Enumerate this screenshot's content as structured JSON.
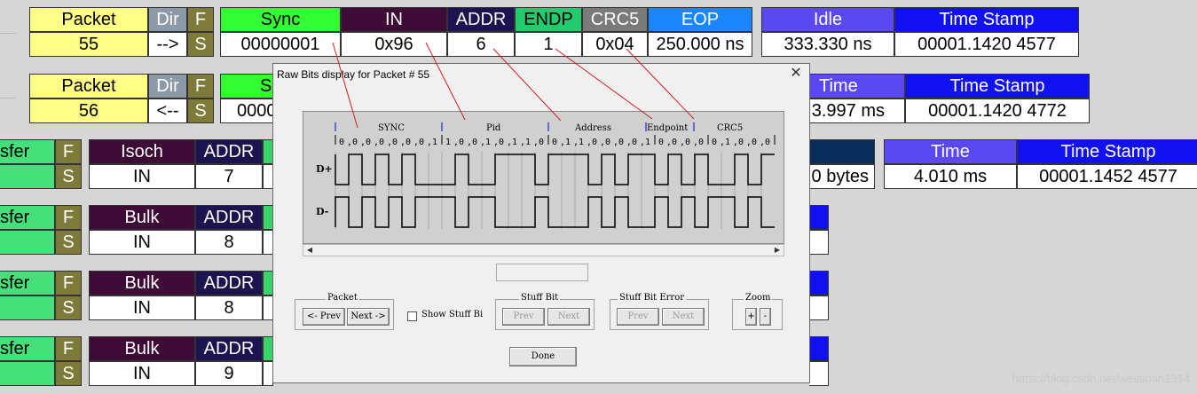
{
  "row1": {
    "headers": [
      "Packet",
      "Dir",
      "F",
      "Sync",
      "IN",
      "ADDR",
      "ENDP",
      "CRC5",
      "EOP",
      "Idle",
      "Time Stamp"
    ],
    "values": [
      "55",
      "-->",
      "S",
      "00000001",
      "0x96",
      "6",
      "1",
      "0x04",
      "250.000 ns",
      "333.330 ns",
      "00001.1420 4577"
    ]
  },
  "row2": {
    "headers": [
      "Packet",
      "Dir",
      "F",
      "S",
      "Time",
      "Time Stamp"
    ],
    "values": [
      "56",
      "<--",
      "S",
      "0000",
      "3.997 ms",
      "00001.1420 4772"
    ]
  },
  "row3": {
    "headers": [
      "sfer",
      "F",
      "Isoch",
      "ADDR",
      "Time",
      "Time Stamp"
    ],
    "values": [
      "S",
      "IN",
      "7",
      "0 bytes",
      "4.010 ms",
      "00001.1452 4577"
    ]
  },
  "row4": {
    "headers": [
      "sfer",
      "F",
      "Bulk",
      "ADDR"
    ],
    "values": [
      "S",
      "IN",
      "8"
    ]
  },
  "row5": {
    "headers": [
      "sfer",
      "F",
      "Bulk",
      "ADDR"
    ],
    "values": [
      "S",
      "IN",
      "8"
    ]
  },
  "row6": {
    "headers": [
      "sfer",
      "F",
      "Bulk",
      "ADDR"
    ],
    "values": [
      "S",
      "IN",
      "9"
    ]
  },
  "dialog": {
    "title": "Raw Bits display for Packet # 55",
    "close": "✕",
    "fields": [
      "SYNC",
      "Pid",
      "Address",
      "Endpoint",
      "CRC5"
    ],
    "bits": "0,0,0,0,0,0,0,1|1,0,0,1,0,1,1,0|0,1,1,0,0,0,0,1|0,0,0,0|0,1,0,0,0",
    "dplus": "D+",
    "dminus": "D-",
    "packet_group": "Packet",
    "prev": "<- Prev",
    "next": "Next ->",
    "show_stuff": "Show Stuff Bi",
    "stuff_group": "Stuff Bit",
    "stuff_prev": "Prev",
    "stuff_next": "Next",
    "stuff_err_group": "Stuff Bit Error",
    "err_prev": "Prev",
    "err_next": "Next",
    "zoom_group": "Zoom",
    "zoom_in": "+",
    "zoom_out": "-",
    "done": "Done"
  },
  "watermark": "https://blog.csdn.net/weiaipan1314",
  "colors": {
    "sync": "#33ff33",
    "in": "#3d0b36",
    "addr": "#1c1450",
    "endp": "#22cc6e",
    "crc": "#7a7a7a",
    "eop": "#1a86ff",
    "idle": "#5a48f0",
    "ts": "#1010f0",
    "packet": "#ffff88"
  }
}
